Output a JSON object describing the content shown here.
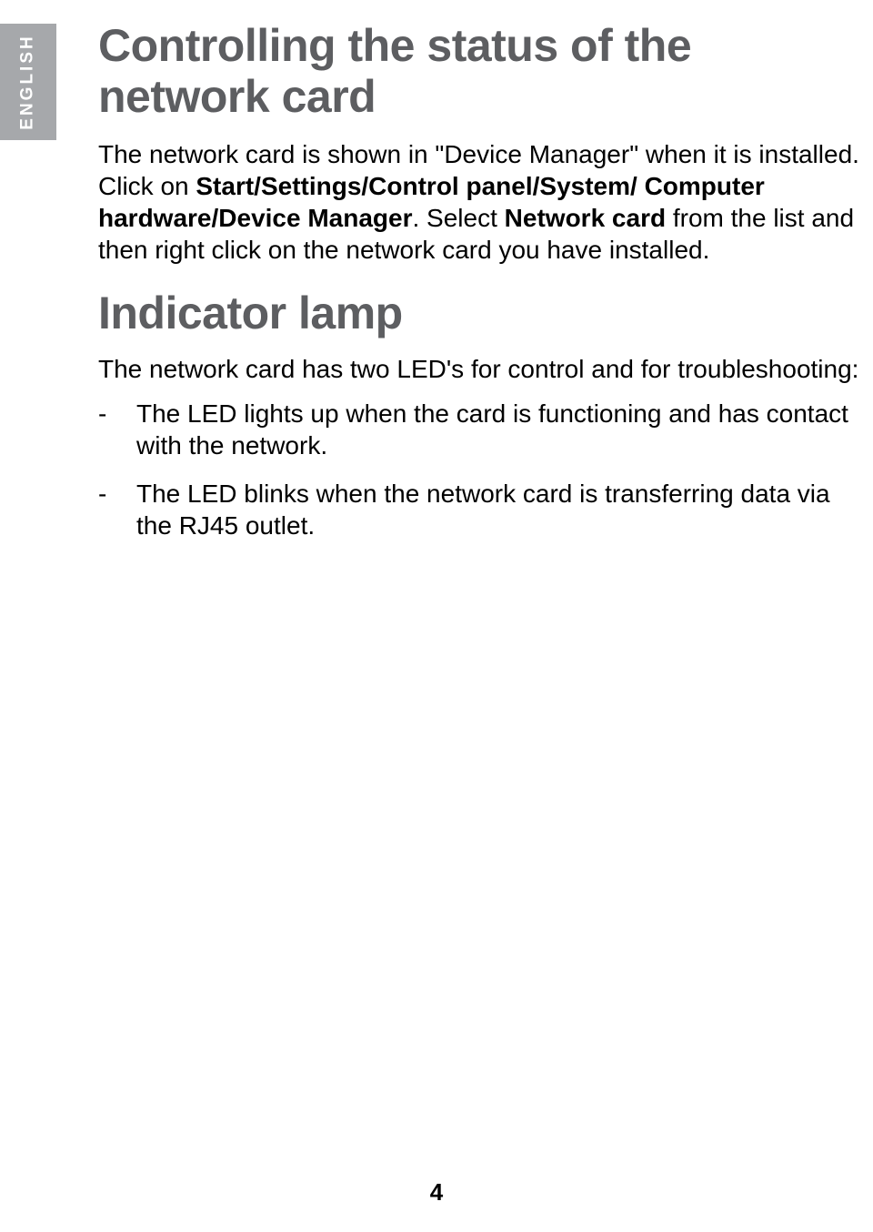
{
  "side_label": "ENGLISH",
  "heading1": "Controlling the status of the network card",
  "para1_a": "The network card is shown in \"Device Manager\" when it is installed. Click on ",
  "para1_b_bold": "Start/Settings/Control panel/System/ Computer hardware/Device Manager",
  "para1_c": ". Select ",
  "para1_d_bold": "Network card",
  "para1_e": " from the list and then right click on the network card you have installed.",
  "heading2": "Indicator lamp",
  "para2": "The network card has two LED's for control and for troubleshooting:",
  "bullets": [
    "The LED lights up when the card is functioning and has contact with the network.",
    "The LED blinks when the network card is transferring data via the RJ45 outlet."
  ],
  "page_number": "4"
}
